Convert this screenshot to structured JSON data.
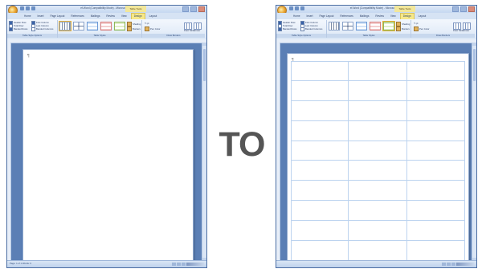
{
  "separator_text": "TO",
  "left_window": {
    "title": "ef-Word (Compatibility Mode) - Microsoft Word",
    "context_tab": "Table Tools",
    "tabs": [
      "Home",
      "Insert",
      "Page Layout",
      "References",
      "Mailings",
      "Review",
      "View",
      "Design",
      "Layout"
    ],
    "active_tab": "Design",
    "options_group": "Table Style Options",
    "styles_group": "Table Styles",
    "borders_group": "Draw Borders",
    "checkboxes": [
      {
        "label": "Header Row",
        "checked": true
      },
      {
        "label": "First Column",
        "checked": true
      },
      {
        "label": "Total Row",
        "checked": false
      },
      {
        "label": "Last Column",
        "checked": false
      },
      {
        "label": "Banded Rows",
        "checked": true
      },
      {
        "label": "Banded Columns",
        "checked": false
      }
    ],
    "tools": [
      "Shading",
      "Borders"
    ],
    "draw_buttons": [
      "Draw Table",
      "Eraser"
    ],
    "pen_weight": "½ pt",
    "pen_color": "Pen Color",
    "status": "Page: 1 of 1   Words: 0",
    "paragraph_mark": "¶"
  },
  "right_window": {
    "title": "ef-Word (Compatibility Mode) - Microsoft Word",
    "context_tab": "Table Tools",
    "tabs": [
      "Home",
      "Insert",
      "Page Layout",
      "References",
      "Mailings",
      "Review",
      "View",
      "Design",
      "Layout"
    ],
    "active_tab": "Design",
    "options_group": "Table Style Options",
    "styles_group": "Table Styles",
    "borders_group": "Draw Borders",
    "checkboxes": [
      {
        "label": "Header Row",
        "checked": true
      },
      {
        "label": "First Column",
        "checked": true
      },
      {
        "label": "Total Row",
        "checked": false
      },
      {
        "label": "Last Column",
        "checked": false
      },
      {
        "label": "Banded Rows",
        "checked": true
      },
      {
        "label": "Banded Columns",
        "checked": false
      }
    ],
    "tools": [
      "Shading",
      "Borders"
    ],
    "draw_buttons": [
      "Draw Table",
      "Eraser"
    ],
    "pen_weight": "½ pt",
    "pen_color": "Pen Color",
    "label_grid": {
      "columns": 3,
      "rows": 10
    },
    "paragraph_mark": "¶"
  },
  "colors": {
    "window_frame": "#5b7fb5",
    "ribbon": "#dbe7f6",
    "active_tab": "#f6e889",
    "grid_line": "#bcd3ef",
    "separator_text": "#555555"
  }
}
